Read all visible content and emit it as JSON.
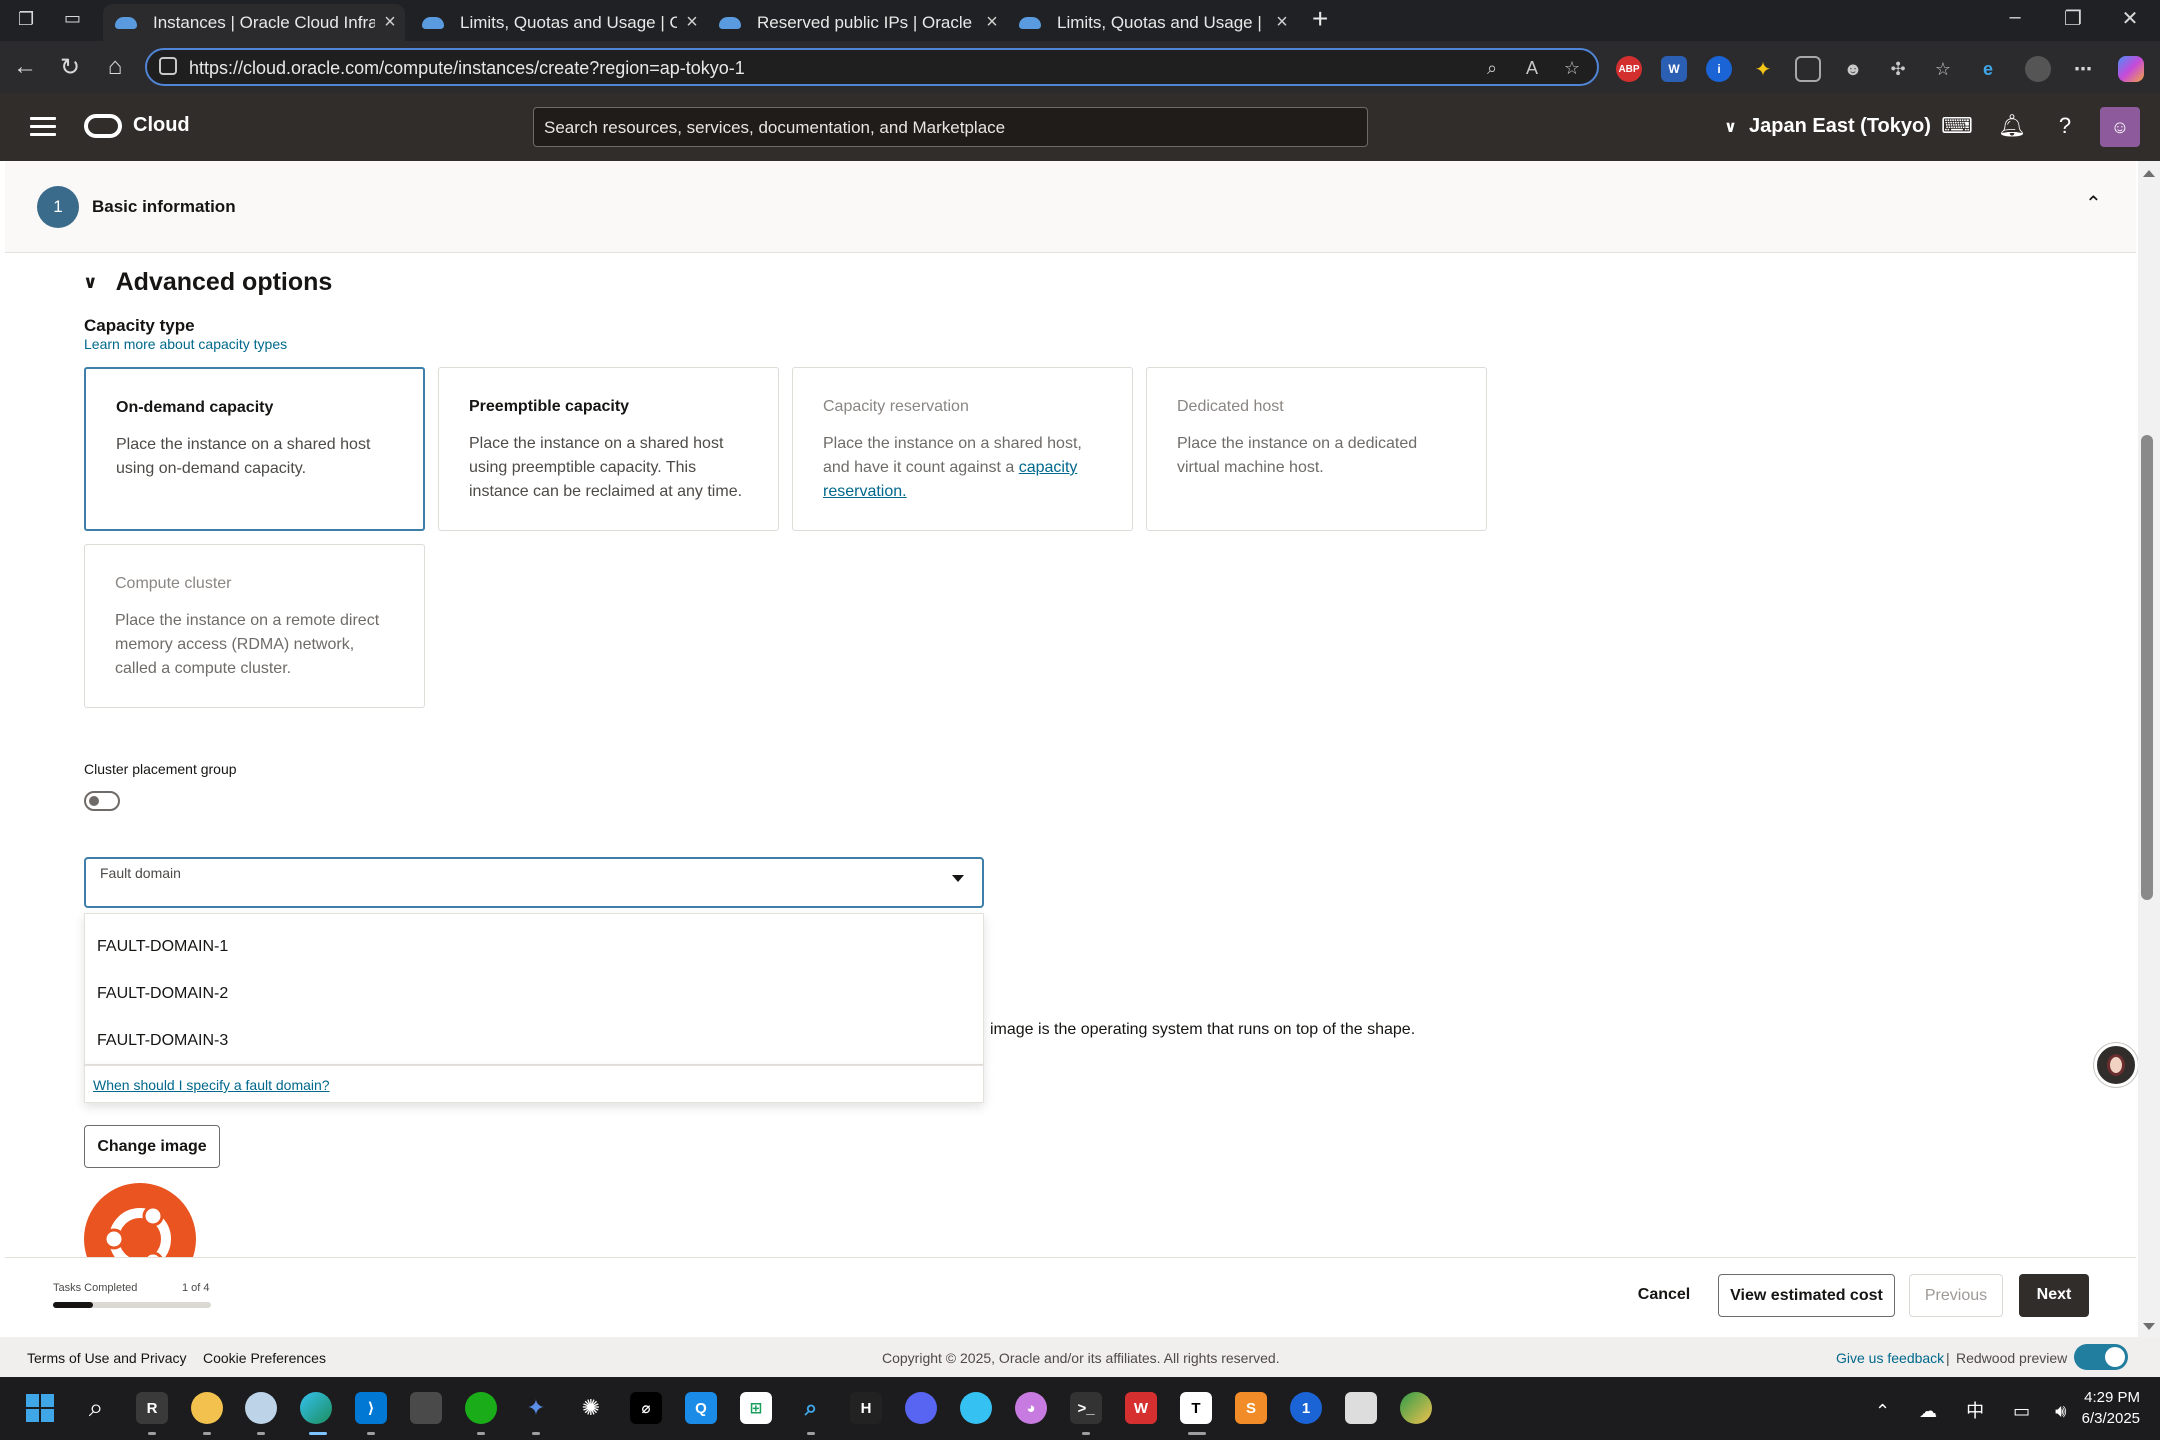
{
  "browser": {
    "tabs": [
      {
        "title": "Instances | Oracle Cloud Infrastru",
        "active": true
      },
      {
        "title": "Limits, Quotas and Usage | Oracle",
        "active": false
      },
      {
        "title": "Reserved public IPs | Oracle Clouc",
        "active": false
      },
      {
        "title": "Limits, Quotas and Usage | Oracle",
        "active": false
      }
    ],
    "url": "https://cloud.oracle.com/compute/instances/create?region=ap-tokyo-1"
  },
  "header": {
    "brand": "Cloud",
    "search_placeholder": "Search resources, services, documentation, and Marketplace",
    "region": "Japan East (Tokyo)"
  },
  "step": {
    "number": "1",
    "title": "Basic information"
  },
  "advanced": {
    "title": "Advanced options",
    "capacity_type_label": "Capacity type",
    "learn_more": "Learn more about capacity types",
    "cards": [
      {
        "title": "On-demand capacity",
        "desc": "Place the instance on a shared host using on-demand capacity.",
        "selected": true,
        "disabled": false
      },
      {
        "title": "Preemptible capacity",
        "desc": "Place the instance on a shared host using preemptible capacity. This instance can be reclaimed at any time.",
        "selected": false,
        "disabled": false
      },
      {
        "title": "Capacity reservation",
        "desc_pre": "Place the instance on a shared host, and have it count against a ",
        "desc_link": "capacity reservation.",
        "selected": false,
        "disabled": true
      },
      {
        "title": "Dedicated host",
        "desc": "Place the instance on a dedicated virtual machine host.",
        "selected": false,
        "disabled": true
      },
      {
        "title": "Compute cluster",
        "desc": "Place the instance on a remote direct memory access (RDMA) network, called a compute cluster.",
        "selected": false,
        "disabled": true
      }
    ],
    "cluster_placement_label": "Cluster placement group",
    "fault_domain": {
      "label": "Fault domain",
      "options": [
        "FAULT-DOMAIN-1",
        "FAULT-DOMAIN-2",
        "FAULT-DOMAIN-3"
      ],
      "help_link": "When should I specify a fault domain?"
    },
    "image_text": "image is the operating system that runs on top of the shape.",
    "change_image": "Change image"
  },
  "footer_bar": {
    "tasks_label": "Tasks Completed",
    "tasks_count": "1 of 4",
    "progress": 0.25,
    "cancel": "Cancel",
    "view_cost": "View estimated cost",
    "previous": "Previous",
    "next": "Next"
  },
  "page_footer": {
    "terms": "Terms of Use and Privacy",
    "cookies": "Cookie Preferences",
    "copyright": "Copyright © 2025, Oracle and/or its affiliates. All rights reserved.",
    "feedback": "Give us feedback",
    "separator": "|",
    "redwood": "Redwood preview"
  },
  "taskbar": {
    "time": "4:29 PM",
    "date": "6/3/2025",
    "ime": "中"
  },
  "colors": {
    "oracle_header": "#312d2a",
    "accent_blue": "#3d7fa8",
    "link": "#00688c",
    "ubuntu_orange": "#e95420"
  }
}
